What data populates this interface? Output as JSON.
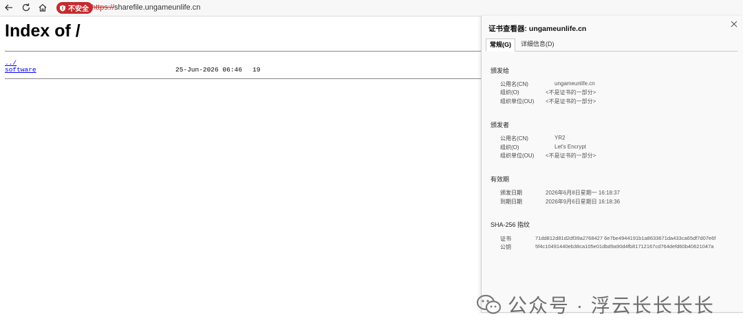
{
  "browser": {
    "security_badge": "不安全",
    "url_scheme": "https://",
    "url_host": "sharefile.ungameunlife.cn"
  },
  "listing": {
    "title": "Index of /",
    "parent_link": "../",
    "entries": [
      {
        "name": "software",
        "date": "25-Jun-2026 06:46",
        "size": "19"
      }
    ]
  },
  "cert_viewer": {
    "title": "证书查看器: ungameunlife.cn",
    "tabs": [
      "常规(G)",
      "详细信息(D)"
    ],
    "issued_to": {
      "heading": "颁发给",
      "rows": [
        {
          "label": "公用名(CN)",
          "value": "ungameunlife.cn"
        },
        {
          "label": "组织(O)",
          "value": "<不是证书的一部分>"
        },
        {
          "label": "组织单位(OU)",
          "value": "<不是证书的一部分>"
        }
      ]
    },
    "issued_by": {
      "heading": "颁发者",
      "rows": [
        {
          "label": "公用名(CN)",
          "value": "YR2"
        },
        {
          "label": "组织(O)",
          "value": "Let's Encrypt"
        },
        {
          "label": "组织单位(OU)",
          "value": "<不是证书的一部分>"
        }
      ]
    },
    "validity": {
      "heading": "有效期",
      "rows": [
        {
          "label": "颁发日期",
          "value": "2026年6月8日星期一 16:18:37"
        },
        {
          "label": "到期日期",
          "value": "2026年9月6日星期日 16:18:36"
        }
      ]
    },
    "fingerprints": {
      "heading": "SHA-256 指纹",
      "rows": [
        {
          "label": "证书",
          "value": "71dd812d81d2df39a2768427 6e7be4944191b1a8633671da433ca65df7d07e6f"
        },
        {
          "label": "公钥",
          "value": "5f4c10491440eb38ca105e01dbd9a90d4fb81712167cd764defd60b40621047a"
        }
      ]
    }
  },
  "watermark": {
    "text": "公众号 · 浮云长长长长"
  },
  "icons": {
    "back": "arrow-left-icon",
    "reload": "reload-icon",
    "home": "home-icon",
    "badge": "shield-alert-icon",
    "close": "close-icon",
    "watermark": "wechat-icon"
  },
  "colors": {
    "insecure_badge": "#c42b2f",
    "link": "#0000ee"
  }
}
